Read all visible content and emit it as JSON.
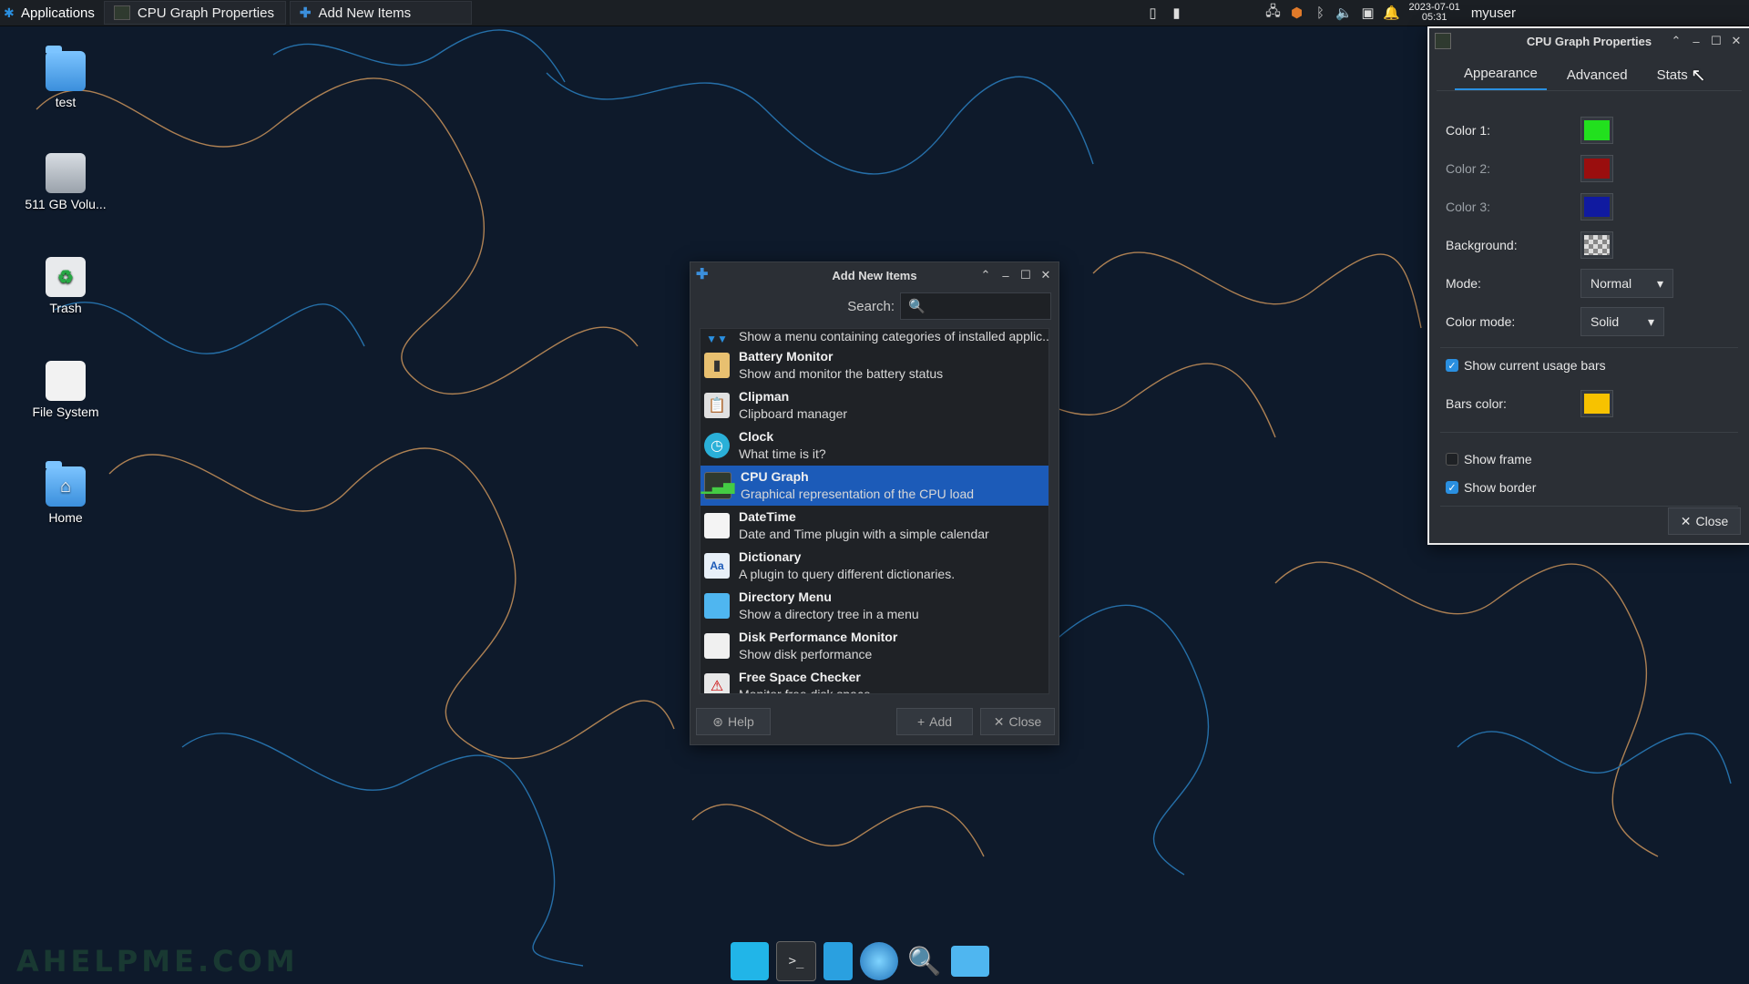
{
  "panel": {
    "apps_label": "Applications",
    "tasks": [
      {
        "label": "CPU Graph Properties"
      },
      {
        "label": "Add New Items"
      }
    ],
    "clock_date": "2023-07-01",
    "clock_time": "05:31",
    "user": "myuser"
  },
  "desktop": {
    "icons": [
      {
        "label": "test",
        "icon": "folder-icon"
      },
      {
        "label": "511 GB Volu...",
        "icon": "drive-icon"
      },
      {
        "label": "Trash",
        "icon": "trash-icon"
      },
      {
        "label": "File System",
        "icon": "filesystem-icon"
      },
      {
        "label": "Home",
        "icon": "home-folder-icon"
      }
    ]
  },
  "add_items": {
    "title": "Add New Items",
    "search_label": "Search:",
    "search_placeholder": "",
    "items": [
      {
        "name": "",
        "desc": "Show a menu containing categories of installed applic..."
      },
      {
        "name": "Battery Monitor",
        "desc": "Show and monitor the battery status"
      },
      {
        "name": "Clipman",
        "desc": "Clipboard manager"
      },
      {
        "name": "Clock",
        "desc": "What time is it?"
      },
      {
        "name": "CPU Graph",
        "desc": "Graphical representation of the CPU load"
      },
      {
        "name": "DateTime",
        "desc": "Date and Time plugin with a simple calendar"
      },
      {
        "name": "Dictionary",
        "desc": "A plugin to query different dictionaries."
      },
      {
        "name": "Directory Menu",
        "desc": "Show a directory tree in a menu"
      },
      {
        "name": "Disk Performance Monitor",
        "desc": "Show disk performance"
      },
      {
        "name": "Free Space Checker",
        "desc": "Monitor free disk space"
      }
    ],
    "selected_item": "CPU Graph",
    "help_label": "Help",
    "add_label": "Add",
    "close_label": "Close"
  },
  "cpu_props": {
    "title": "CPU Graph Properties",
    "tabs": [
      {
        "label": "Appearance"
      },
      {
        "label": "Advanced"
      },
      {
        "label": "Stats"
      }
    ],
    "active_tab": "Appearance",
    "color1_label": "Color 1:",
    "color2_label": "Color 2:",
    "color3_label": "Color 3:",
    "background_label": "Background:",
    "mode_label": "Mode:",
    "mode_value": "Normal",
    "color_mode_label": "Color mode:",
    "color_mode_value": "Solid",
    "show_bars_label": "Show current usage bars",
    "show_bars_checked": true,
    "bars_color_label": "Bars color:",
    "show_frame_label": "Show frame",
    "show_frame_checked": false,
    "show_border_label": "Show border",
    "show_border_checked": true,
    "close_label": "Close",
    "colors": {
      "color1": "#22e01e",
      "color2": "#9a0e0e",
      "color3": "#101aa0",
      "bars": "#f7c200"
    }
  },
  "watermark": "AHELPME.COM",
  "theme": {
    "accent": "#2a8fe0",
    "selection": "#1c5bb8",
    "wallpaper_bg": "#0e1a2b"
  }
}
